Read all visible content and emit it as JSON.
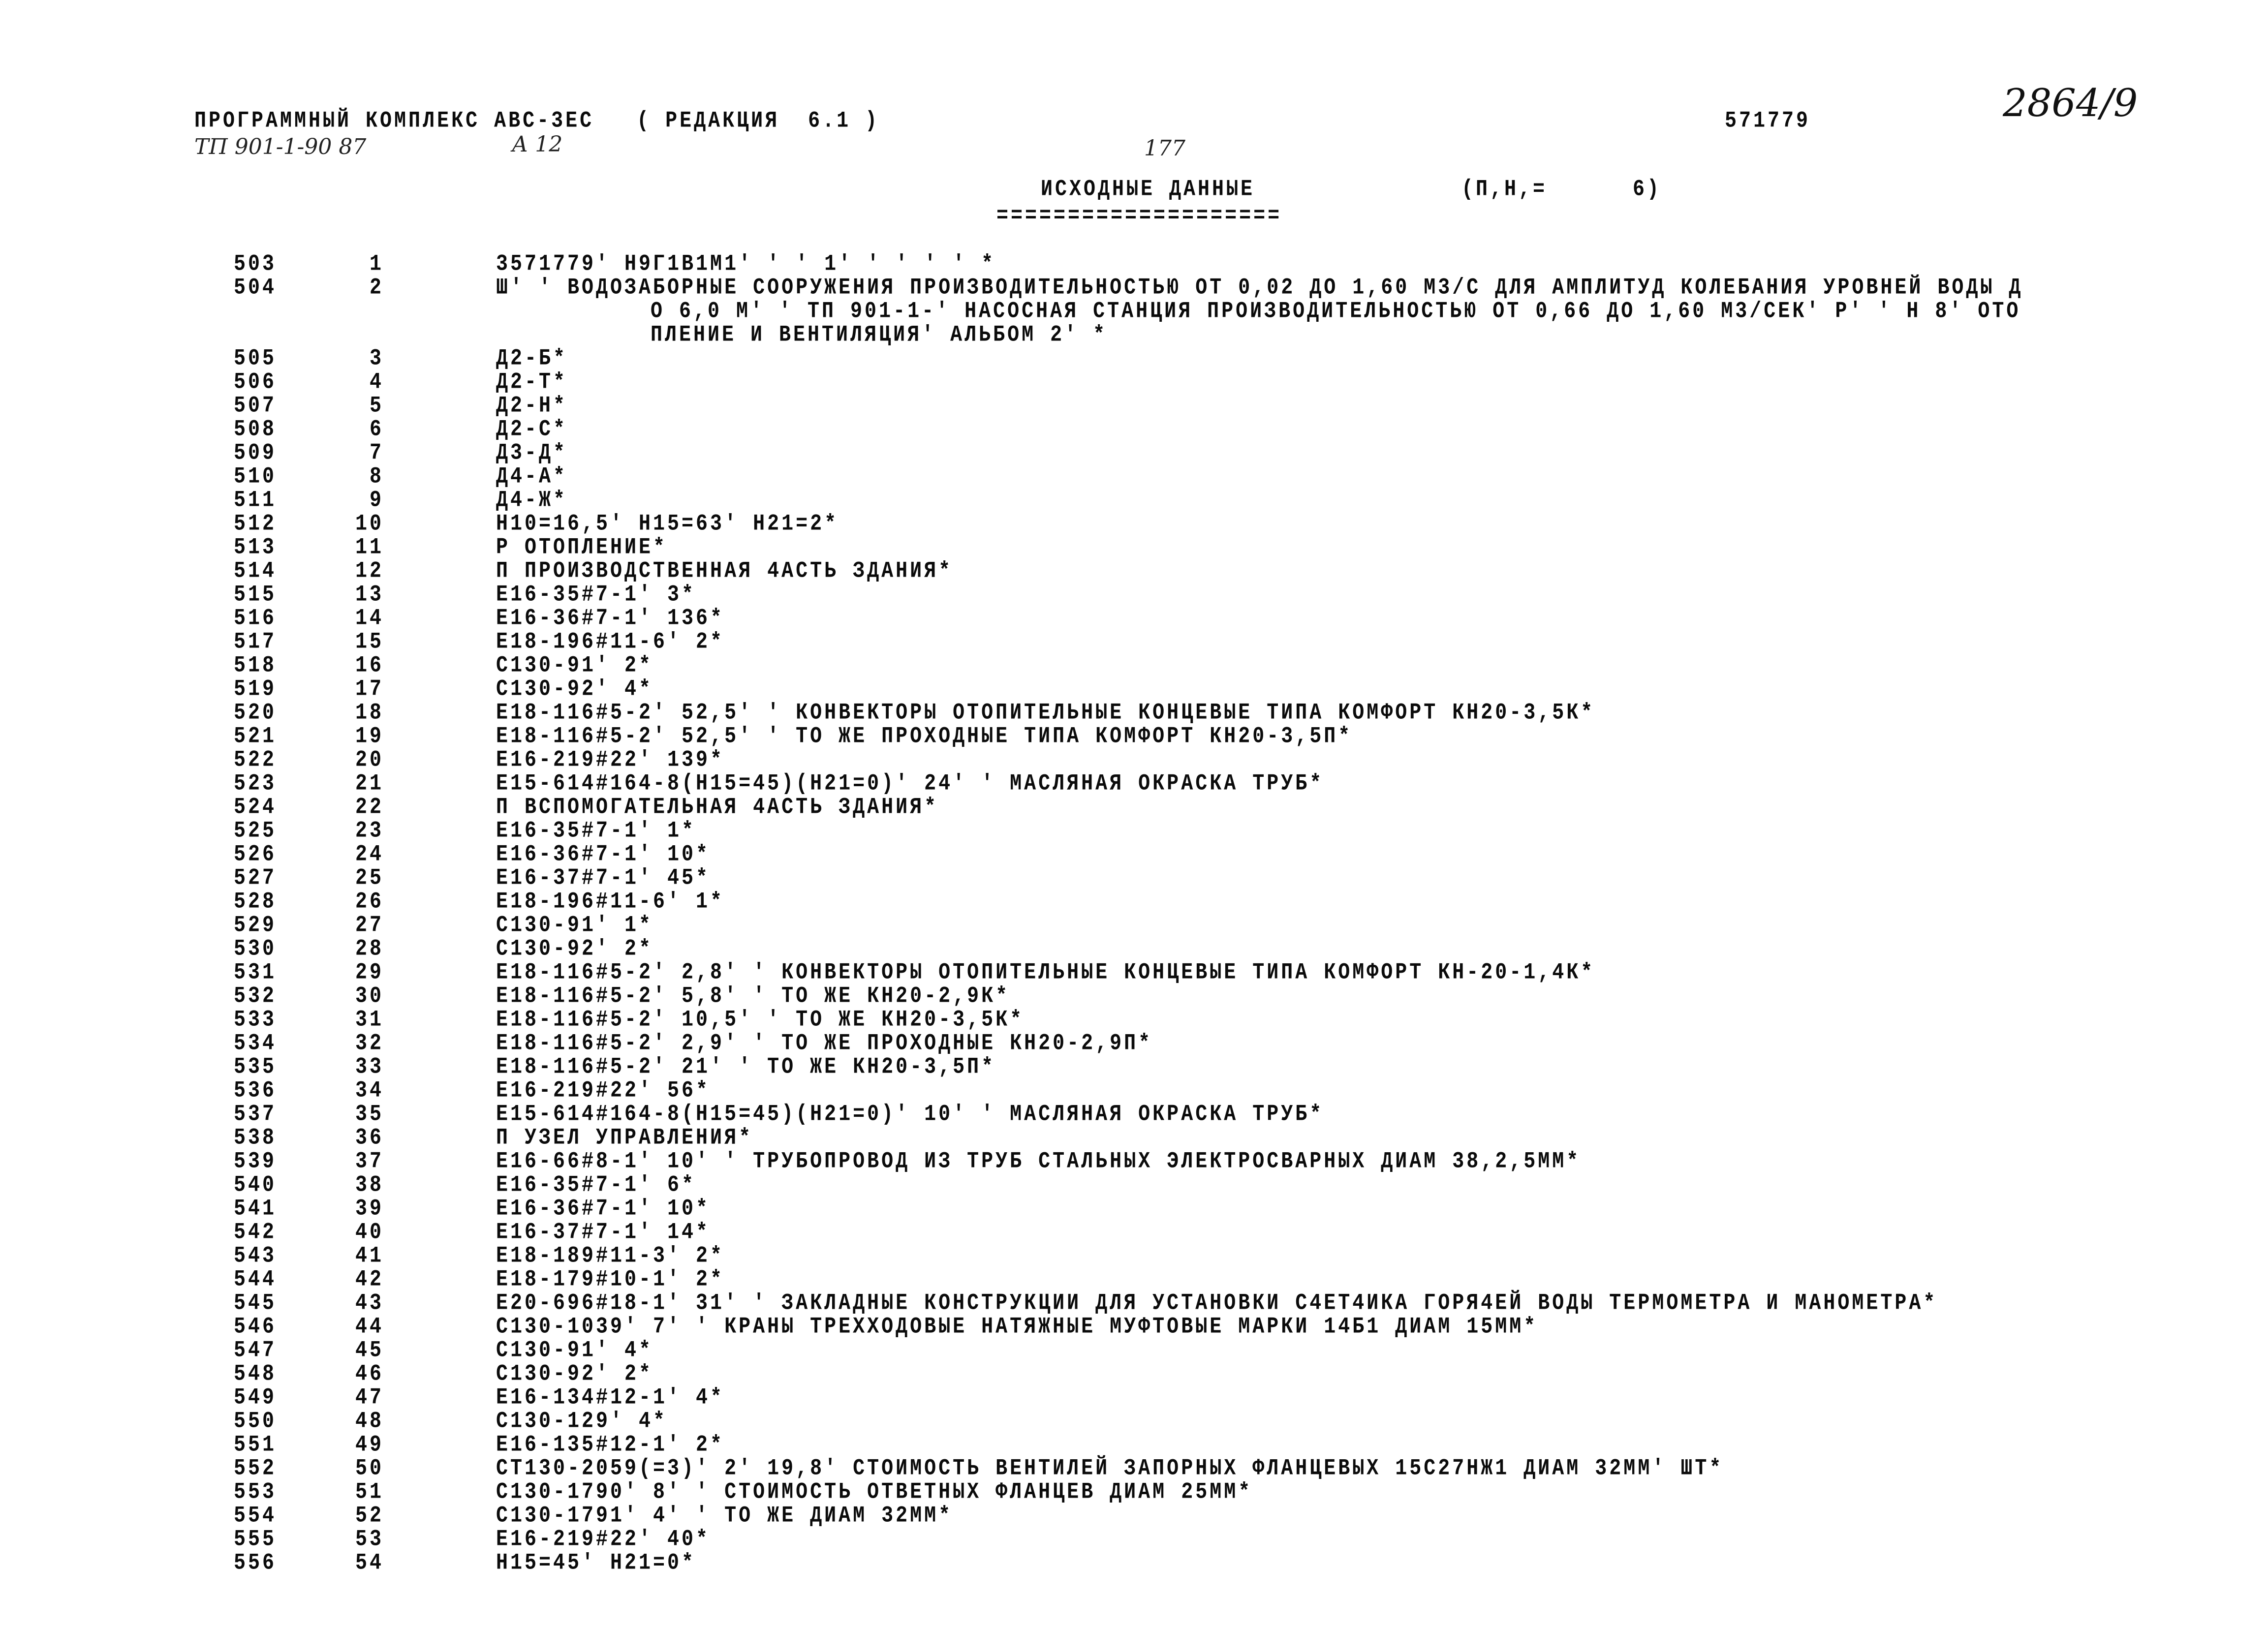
{
  "header": {
    "program": "ПРОГРАММНЫЙ КОМПЛЕКС АВС-3ЕС   ( РЕДАКЦИЯ  6.1 )",
    "code": "571779",
    "project": "ТП 901-1-90 87",
    "album": "А 12",
    "page_number": "177",
    "sheet_mark": "2864/9",
    "section_title": "ИСХОДНЫЕ ДАННЫЕ",
    "section_underline": "====================",
    "params": "(П,Н,=      6)"
  },
  "rows": [
    {
      "n": "503",
      "seq": "1",
      "text": "3571779' Н9Г1В1М1' ' ' 1' ' ' ' ' *"
    },
    {
      "n": "504",
      "seq": "2",
      "text": "Ш' ' ВОДОЗАБОРНЫЕ СООРУЖЕНИЯ ПРОИЗВОДИТЕЛЬНОСТЬЮ ОТ 0,02 ДО 1,60 М3/С ДЛЯ АМПЛИТУД КОЛЕБАНИЯ УРОВНЕЙ ВОДЫ Д"
    },
    {
      "n": "",
      "seq": "",
      "text": "О 6,0 М' ' ТП 901-1-' НАСОСНАЯ СТАНЦИЯ ПРОИЗВОДИТЕЛЬНОСТЬЮ ОТ 0,66 ДО 1,60 М3/СЕК' Р' ' Н 8' ОТО",
      "cont": true
    },
    {
      "n": "",
      "seq": "",
      "text": "ПЛЕНИЕ И ВЕНТИЛЯЦИЯ' АЛЬБОМ 2' *",
      "cont": true
    },
    {
      "n": "505",
      "seq": "3",
      "text": "Д2-Б*"
    },
    {
      "n": "506",
      "seq": "4",
      "text": "Д2-Т*"
    },
    {
      "n": "507",
      "seq": "5",
      "text": "Д2-Н*"
    },
    {
      "n": "508",
      "seq": "6",
      "text": "Д2-С*"
    },
    {
      "n": "509",
      "seq": "7",
      "text": "Д3-Д*"
    },
    {
      "n": "510",
      "seq": "8",
      "text": "Д4-А*"
    },
    {
      "n": "511",
      "seq": "9",
      "text": "Д4-Ж*"
    },
    {
      "n": "512",
      "seq": "10",
      "text": "Н10=16,5' Н15=63' Н21=2*"
    },
    {
      "n": "513",
      "seq": "11",
      "text": "Р ОТОПЛЕНИЕ*"
    },
    {
      "n": "514",
      "seq": "12",
      "text": "П ПРОИЗВОДСТВЕННАЯ 4АСТЬ ЗДАНИЯ*"
    },
    {
      "n": "515",
      "seq": "13",
      "text": "Е16-35#7-1' 3*"
    },
    {
      "n": "516",
      "seq": "14",
      "text": "Е16-36#7-1' 136*"
    },
    {
      "n": "517",
      "seq": "15",
      "text": "Е18-196#11-6' 2*"
    },
    {
      "n": "518",
      "seq": "16",
      "text": "С130-91' 2*"
    },
    {
      "n": "519",
      "seq": "17",
      "text": "С130-92' 4*"
    },
    {
      "n": "520",
      "seq": "18",
      "text": "Е18-116#5-2' 52,5' ' КОНВЕКТОРЫ ОТОПИТЕЛЬНЫЕ КОНЦЕВЫЕ ТИПА КОМФОРТ КН20-3,5К*"
    },
    {
      "n": "521",
      "seq": "19",
      "text": "Е18-116#5-2' 52,5' ' ТО ЖЕ ПРОХОДНЫЕ ТИПА КОМФОРТ КН20-3,5П*"
    },
    {
      "n": "522",
      "seq": "20",
      "text": "Е16-219#22' 139*"
    },
    {
      "n": "523",
      "seq": "21",
      "text": "Е15-614#164-8(Н15=45)(Н21=0)' 24' ' МАСЛЯНАЯ ОКРАСКА ТРУБ*"
    },
    {
      "n": "524",
      "seq": "22",
      "text": "П ВСПОМОГАТЕЛЬНАЯ 4АСТЬ ЗДАНИЯ*"
    },
    {
      "n": "525",
      "seq": "23",
      "text": "Е16-35#7-1' 1*"
    },
    {
      "n": "526",
      "seq": "24",
      "text": "Е16-36#7-1' 10*"
    },
    {
      "n": "527",
      "seq": "25",
      "text": "Е16-37#7-1' 45*"
    },
    {
      "n": "528",
      "seq": "26",
      "text": "Е18-196#11-6' 1*"
    },
    {
      "n": "529",
      "seq": "27",
      "text": "С130-91' 1*"
    },
    {
      "n": "530",
      "seq": "28",
      "text": "С130-92' 2*"
    },
    {
      "n": "531",
      "seq": "29",
      "text": "Е18-116#5-2' 2,8' ' КОНВЕКТОРЫ ОТОПИТЕЛЬНЫЕ КОНЦЕВЫЕ ТИПА КОМФОРТ КН-20-1,4К*"
    },
    {
      "n": "532",
      "seq": "30",
      "text": "Е18-116#5-2' 5,8' ' ТО ЖЕ КН20-2,9К*"
    },
    {
      "n": "533",
      "seq": "31",
      "text": "Е18-116#5-2' 10,5' ' ТО ЖЕ КН20-3,5К*"
    },
    {
      "n": "534",
      "seq": "32",
      "text": "Е18-116#5-2' 2,9' ' ТО ЖЕ ПРОХОДНЫЕ КН20-2,9П*"
    },
    {
      "n": "535",
      "seq": "33",
      "text": "Е18-116#5-2' 21' ' ТО ЖЕ КН20-3,5П*"
    },
    {
      "n": "536",
      "seq": "34",
      "text": "Е16-219#22' 56*"
    },
    {
      "n": "537",
      "seq": "35",
      "text": "Е15-614#164-8(Н15=45)(Н21=0)' 10' ' МАСЛЯНАЯ ОКРАСКА ТРУБ*"
    },
    {
      "n": "538",
      "seq": "36",
      "text": "П УЗЕЛ УПРАВЛЕНИЯ*"
    },
    {
      "n": "539",
      "seq": "37",
      "text": "Е16-66#8-1' 10' ' ТРУБОПРОВОД ИЗ ТРУБ СТАЛЬНЫХ ЭЛЕКТРОСВАРНЫХ ДИАМ 38,2,5ММ*"
    },
    {
      "n": "540",
      "seq": "38",
      "text": "Е16-35#7-1' 6*"
    },
    {
      "n": "541",
      "seq": "39",
      "text": "Е16-36#7-1' 10*"
    },
    {
      "n": "542",
      "seq": "40",
      "text": "Е16-37#7-1' 14*"
    },
    {
      "n": "543",
      "seq": "41",
      "text": "Е18-189#11-3' 2*"
    },
    {
      "n": "544",
      "seq": "42",
      "text": "Е18-179#10-1' 2*"
    },
    {
      "n": "545",
      "seq": "43",
      "text": "Е20-696#18-1' 31' ' ЗАКЛАДНЫЕ КОНСТРУКЦИИ ДЛЯ УСТАНОВКИ С4ЕТ4ИКА ГОРЯ4ЕЙ ВОДЫ ТЕРМОМЕТРА И МАНОМЕТРА*"
    },
    {
      "n": "546",
      "seq": "44",
      "text": "С130-1039' 7' ' КРАНЫ ТРЕХХОДОВЫЕ НАТЯЖНЫЕ МУФТОВЫЕ МАРКИ 14Б1 ДИАМ 15ММ*"
    },
    {
      "n": "547",
      "seq": "45",
      "text": "С130-91' 4*"
    },
    {
      "n": "548",
      "seq": "46",
      "text": "С130-92' 2*"
    },
    {
      "n": "549",
      "seq": "47",
      "text": "Е16-134#12-1' 4*"
    },
    {
      "n": "550",
      "seq": "48",
      "text": "С130-129' 4*"
    },
    {
      "n": "551",
      "seq": "49",
      "text": "Е16-135#12-1' 2*"
    },
    {
      "n": "552",
      "seq": "50",
      "text": "СТ130-2059(=3)' 2' 19,8' СТОИМОСТЬ ВЕНТИЛЕЙ ЗАПОРНЫХ ФЛАНЦЕВЫХ 15С27НЖ1 ДИАМ 32ММ' ШТ*"
    },
    {
      "n": "553",
      "seq": "51",
      "text": "С130-1790' 8' ' СТОИМОСТЬ ОТВЕТНЫХ ФЛАНЦЕВ ДИАМ 25ММ*"
    },
    {
      "n": "554",
      "seq": "52",
      "text": "С130-1791' 4' ' ТО ЖЕ ДИАМ 32ММ*"
    },
    {
      "n": "555",
      "seq": "53",
      "text": "Е16-219#22' 40*"
    },
    {
      "n": "556",
      "seq": "54",
      "text": "Н15=45' Н21=0*"
    }
  ]
}
